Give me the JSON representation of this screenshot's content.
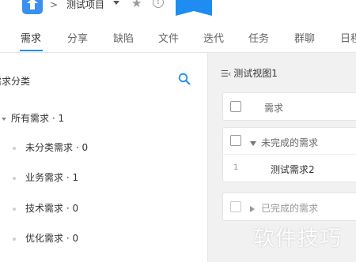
{
  "topbar": {
    "separator": ">",
    "project_name": "测试项目",
    "icons": [
      "app-logo-icon",
      "chevron-down-icon",
      "star-icon",
      "info-icon",
      "bookmark-icon"
    ]
  },
  "tabs": [
    {
      "label": "需求",
      "active": true
    },
    {
      "label": "分享"
    },
    {
      "label": "缺陷"
    },
    {
      "label": "文件"
    },
    {
      "label": "迭代"
    },
    {
      "label": "任务"
    },
    {
      "label": "群聊"
    },
    {
      "label": "日程"
    }
  ],
  "left": {
    "title": "需求分类",
    "tree_root": "所有需求 · 1",
    "items": [
      {
        "label": "未分类需求 · 0"
      },
      {
        "label": "业务需求 · 1"
      },
      {
        "label": "技术需求 · 0"
      },
      {
        "label": "优化需求 · 0"
      }
    ]
  },
  "right": {
    "view_title": "测试视图1",
    "table_header": "需求",
    "group_incomplete": "未完成的需求",
    "rows": [
      {
        "num": "1",
        "title": "测试需求2"
      }
    ],
    "group_complete": "已完成的需求"
  },
  "watermark": "软件技巧",
  "colors": {
    "accent": "#1e8cf0",
    "right_bg": "#f1f1f1"
  }
}
